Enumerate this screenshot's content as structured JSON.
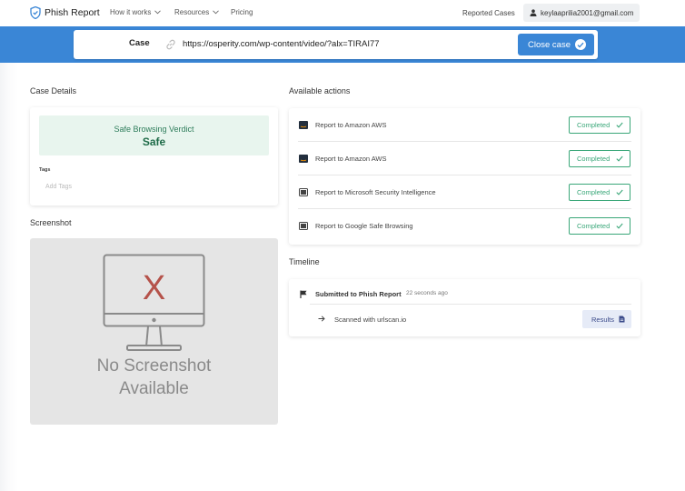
{
  "nav": {
    "brand": "Phish Report",
    "items": [
      {
        "label": "How it works",
        "has_chevron": true
      },
      {
        "label": "Resources",
        "has_chevron": true
      },
      {
        "label": "Pricing",
        "has_chevron": false
      }
    ],
    "reported_cases": "Reported Cases",
    "user_email": "keylaaprilia2001@gmail.com"
  },
  "case": {
    "label": "Case",
    "url": "https://osperity.com/wp-content/video/?alx=TIRAI77",
    "close_label": "Close case"
  },
  "details": {
    "title": "Case Details",
    "verdict_title": "Safe Browsing Verdict",
    "verdict_value": "Safe",
    "tags_label": "Tags",
    "tags_placeholder": "Add Tags"
  },
  "screenshot": {
    "title": "Screenshot",
    "placeholder_line1": "No Screenshot",
    "placeholder_line2": "Available",
    "mark": "X"
  },
  "actions": {
    "title": "Available actions",
    "items": [
      {
        "label": "Report to Amazon AWS",
        "icon": "aws-icon",
        "status": "Completed"
      },
      {
        "label": "Report to Amazon AWS",
        "icon": "aws-icon",
        "status": "Completed"
      },
      {
        "label": "Report to Microsoft Security Intelligence",
        "icon": "microsoft-icon",
        "status": "Completed"
      },
      {
        "label": "Report to Google Safe Browsing",
        "icon": "google-icon",
        "status": "Completed"
      }
    ]
  },
  "timeline": {
    "title": "Timeline",
    "event_title": "Submitted to Phish Report",
    "event_time": "22 seconds ago",
    "sub_event": "Scanned with urlscan.io",
    "results_label": "Results"
  },
  "colors": {
    "accent": "#3a86d6",
    "success": "#3aa779",
    "verdict_bg": "#e8f5ee"
  }
}
